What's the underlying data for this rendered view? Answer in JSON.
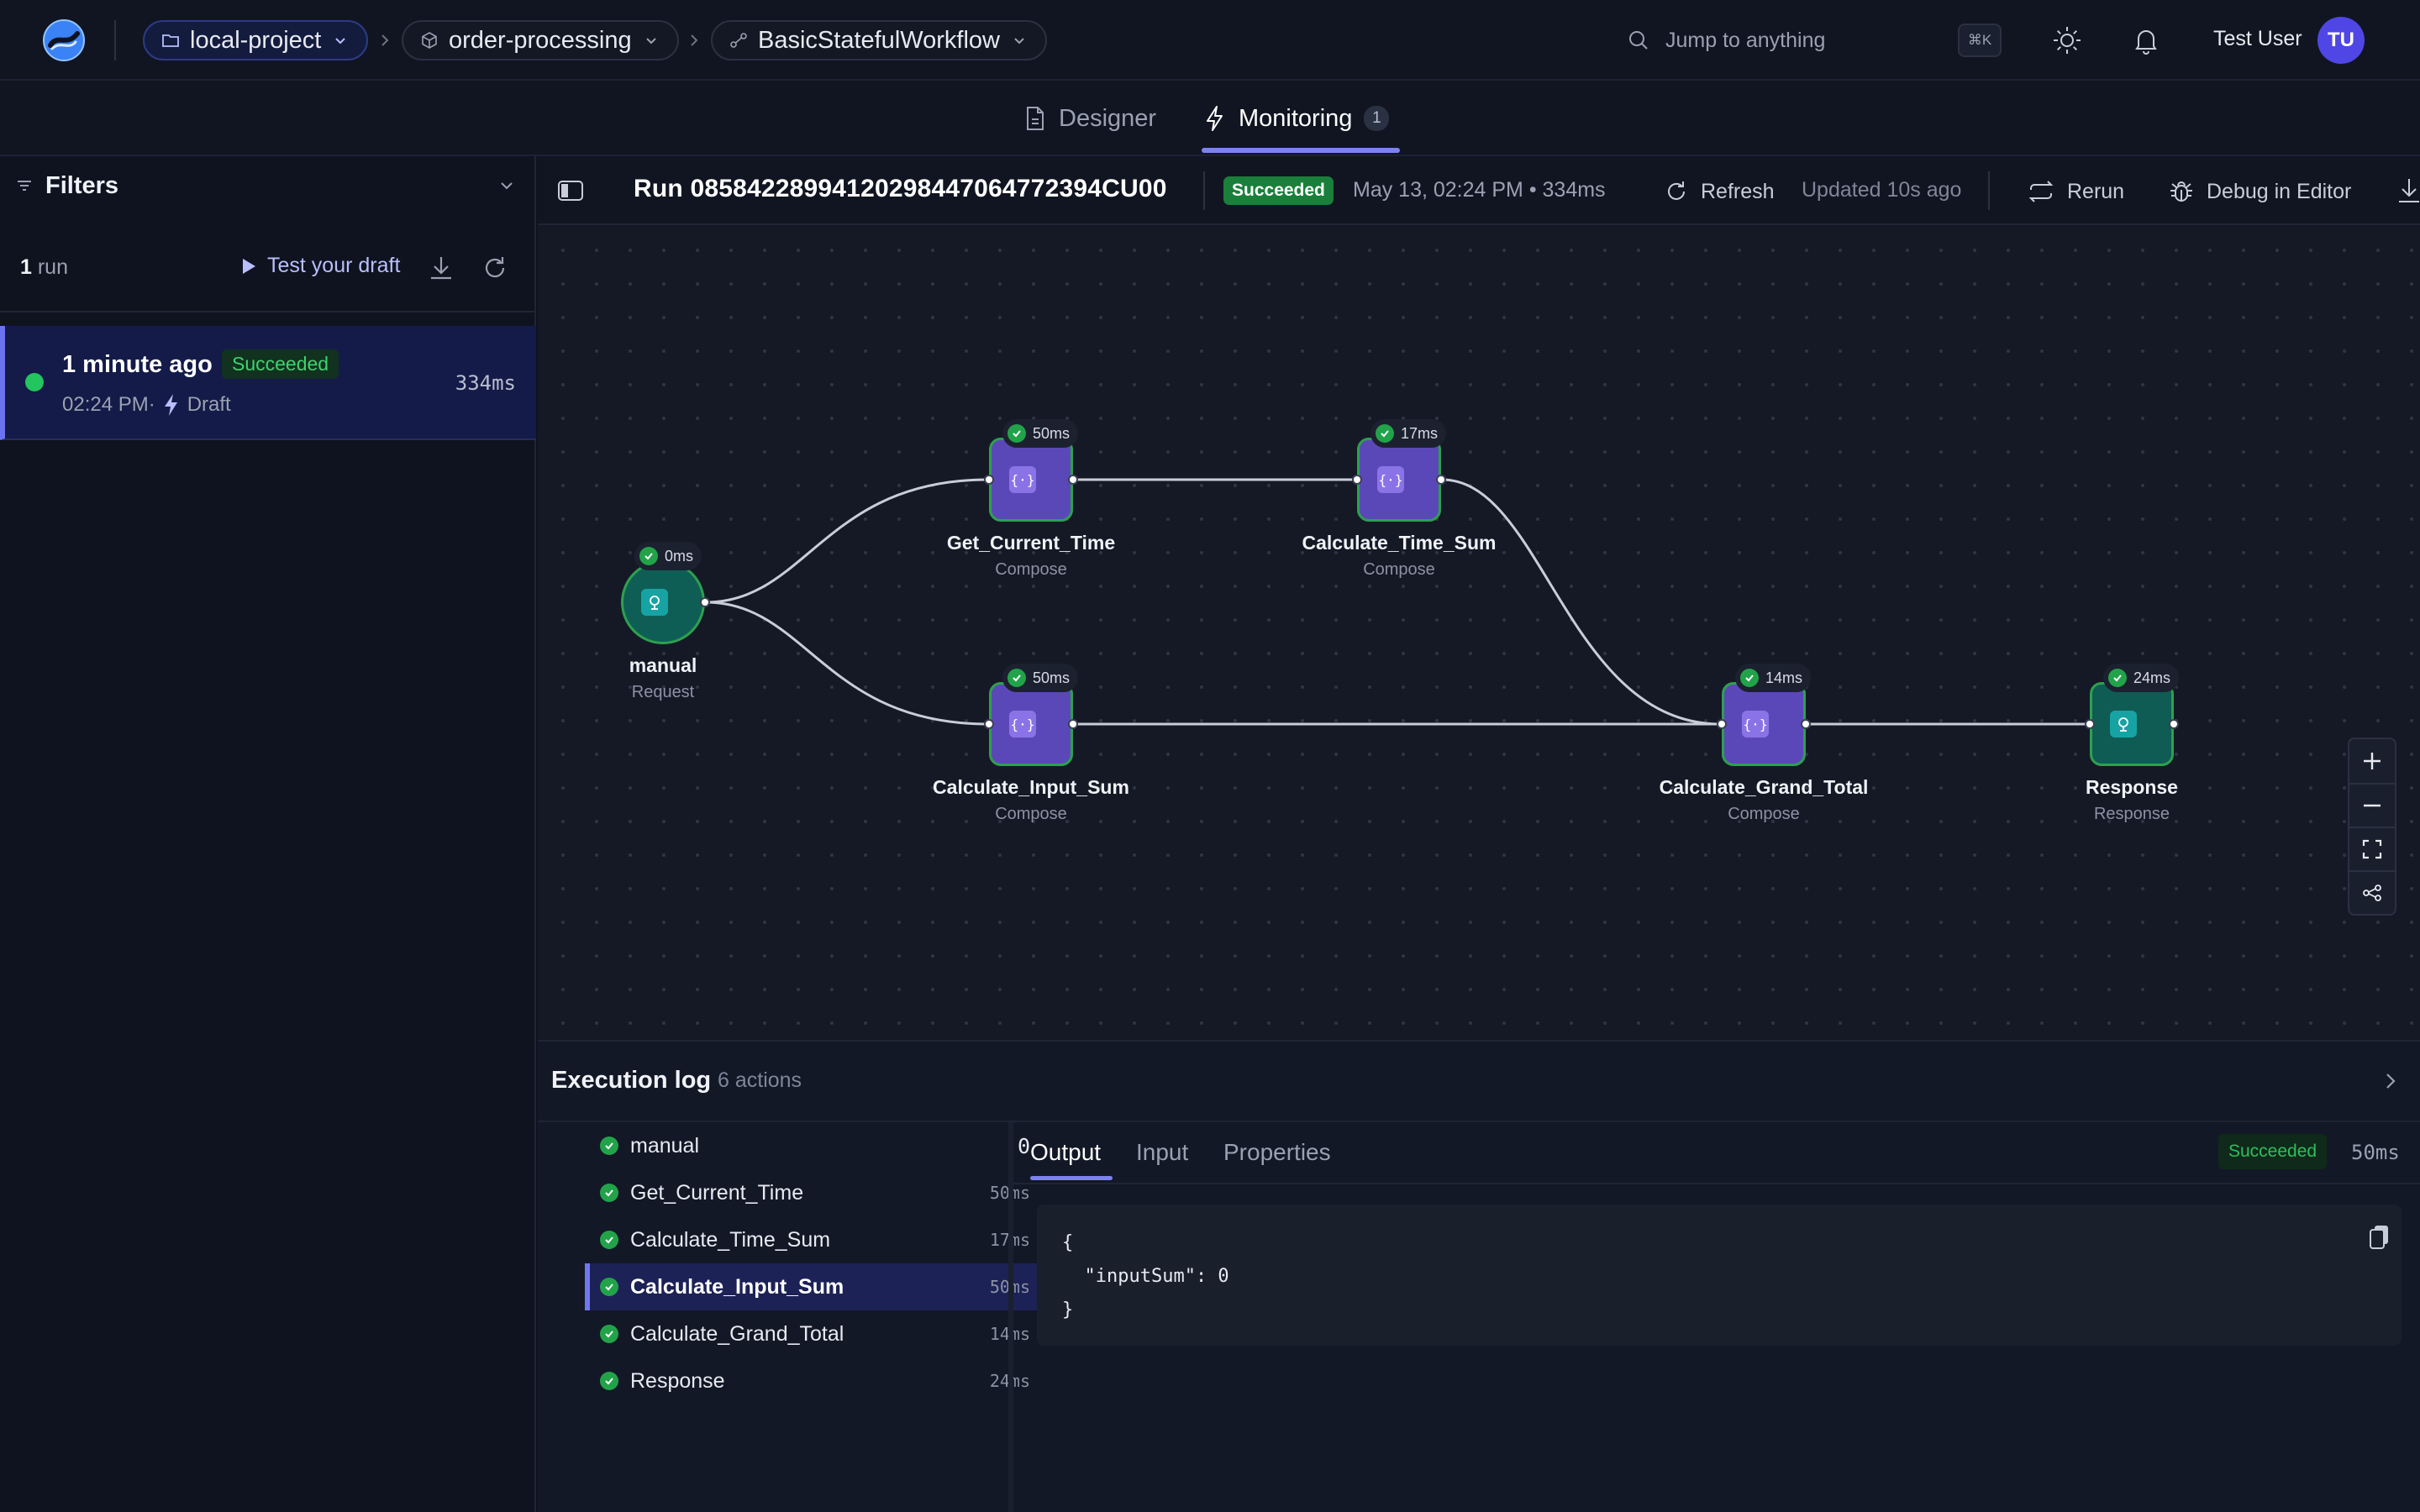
{
  "topbar": {
    "breadcrumbs": [
      {
        "label": "local-project"
      },
      {
        "label": "order-processing"
      },
      {
        "label": "BasicStatefulWorkflow"
      }
    ],
    "search_placeholder": "Jump to anything",
    "shortcut": "⌘K",
    "user_name": "Test User",
    "user_initials": "TU"
  },
  "tabs": [
    {
      "label": "Designer"
    },
    {
      "label": "Monitoring",
      "badge": "1"
    }
  ],
  "filters": {
    "title": "Filters",
    "run_count": "1",
    "run_count_suffix": "run",
    "test_draft_label": "Test your draft"
  },
  "run_list": [
    {
      "time_ago": "1 minute ago",
      "status": "Succeeded",
      "time": "02:24 PM·",
      "version": "Draft",
      "duration": "334ms"
    }
  ],
  "run_header": {
    "run_id": "Run 08584228994120298447064772394CU00",
    "status": "Succeeded",
    "meta": "May 13, 02:24 PM  •  334ms",
    "refresh_label": "Refresh",
    "updated": "Updated 10s ago",
    "rerun_label": "Rerun",
    "debug_label": "Debug in Editor"
  },
  "graph": {
    "nodes": [
      {
        "name": "manual",
        "type": "Request",
        "duration": "0ms"
      },
      {
        "name": "Get_Current_Time",
        "type": "Compose",
        "duration": "50ms"
      },
      {
        "name": "Calculate_Time_Sum",
        "type": "Compose",
        "duration": "17ms"
      },
      {
        "name": "Calculate_Input_Sum",
        "type": "Compose",
        "duration": "50ms"
      },
      {
        "name": "Calculate_Grand_Total",
        "type": "Compose",
        "duration": "14ms"
      },
      {
        "name": "Response",
        "type": "Response",
        "duration": "24ms"
      }
    ],
    "compose_glyph": "{·}"
  },
  "execution_log": {
    "title": "Execution log",
    "count": "6 actions",
    "actions": [
      {
        "name": "manual",
        "duration": "0"
      },
      {
        "name": "Get_Current_Time",
        "duration": "50ms"
      },
      {
        "name": "Calculate_Time_Sum",
        "duration": "17ms"
      },
      {
        "name": "Calculate_Input_Sum",
        "duration": "50ms"
      },
      {
        "name": "Calculate_Grand_Total",
        "duration": "14ms"
      },
      {
        "name": "Response",
        "duration": "24ms"
      }
    ],
    "selected_index": 3,
    "detail_tabs": [
      {
        "label": "Output"
      },
      {
        "label": "Input"
      },
      {
        "label": "Properties"
      }
    ],
    "detail_status": "Succeeded",
    "detail_duration": "50ms",
    "output_lines": [
      "{",
      "  \"inputSum\": 0",
      "}"
    ]
  },
  "colors": {
    "accent": "#7c83f0",
    "success": "#22c55e",
    "node_compose": "#5b48b8",
    "node_trigger": "#0f5e55"
  }
}
